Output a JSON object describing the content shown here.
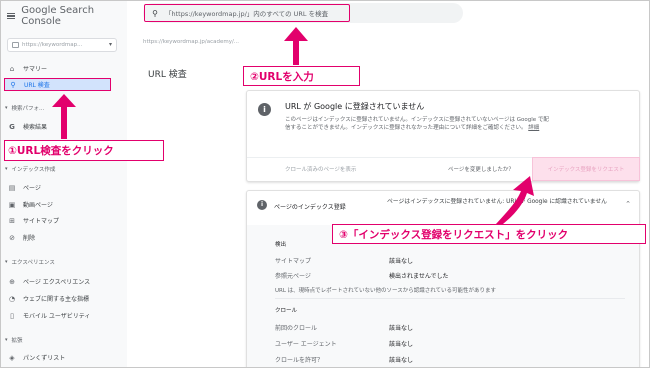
{
  "app": {
    "brand": "Google Search Console",
    "property_text": "https://keywordmap...",
    "current_url": "https://keywordmap.jp/academy/...",
    "page_title": "URL 検査"
  },
  "search": {
    "placeholder": "「https://keywordmap.jp/」内のすべての URL を検査"
  },
  "sidebar": {
    "items": [
      {
        "label": "サマリー",
        "icon": "home-icon"
      },
      {
        "label": "URL 検査",
        "icon": "search-icon",
        "active": true
      },
      {
        "section": "検索パフォ..."
      },
      {
        "label": "検索結果",
        "icon": "google-icon"
      },
      {
        "section": "インデックス作成"
      },
      {
        "label": "ページ",
        "icon": "pages-icon"
      },
      {
        "label": "動画ページ",
        "icon": "video-icon"
      },
      {
        "label": "サイトマップ",
        "icon": "sitemap-icon"
      },
      {
        "label": "削除",
        "icon": "removal-icon"
      },
      {
        "section": "エクスペリエンス"
      },
      {
        "label": "ページ エクスペリエンス",
        "icon": "experience-icon"
      },
      {
        "label": "ウェブに関する主な指標",
        "icon": "vitals-icon"
      },
      {
        "label": "モバイル ユーザビリティ",
        "icon": "mobile-icon"
      },
      {
        "section": "拡張"
      },
      {
        "label": "パンくずリスト",
        "icon": "breadcrumb-icon"
      }
    ]
  },
  "status_card": {
    "title": "URL が Google に登録されていません",
    "description": "このページはインデックスに登録されていません。インデックスに登録されていないページは Google で配信することができません。インデックスに登録されなかった理由について詳細をご確認ください。",
    "detail_link": "詳細",
    "crawl_link": "クロール済みのページを表示",
    "changed_text": "ページを変更しましたか？",
    "request_button": "インデックス登録をリクエスト"
  },
  "indexing_card": {
    "label": "ページのインデックス登録",
    "status": "ページはインデックスに登録されていません: URL が Google に認識されていません",
    "discovery_heading": "検出",
    "sitemap_label": "サイトマップ",
    "sitemap_value": "該当なし",
    "referrer_label": "参照元ページ",
    "referrer_value": "検出されませんでした",
    "note": "URL は、現時点でレポートされていない他のソースから認識されている可能性があります",
    "crawl_heading": "クロール",
    "last_crawl_label": "前回のクロール",
    "last_crawl_value": "該当なし",
    "user_agent_label": "ユーザー エージェント",
    "user_agent_value": "該当なし",
    "crawl_allowed_label": "クロールを許可？",
    "crawl_allowed_value": "該当なし"
  },
  "annotations": {
    "step1": "①URL検査をクリック",
    "step2": "②URLを入力",
    "step3": "③「インデックス登録をリクエスト」をクリック"
  },
  "colors": {
    "accent": "#e2006c",
    "active_bg": "#d2e3fc"
  }
}
